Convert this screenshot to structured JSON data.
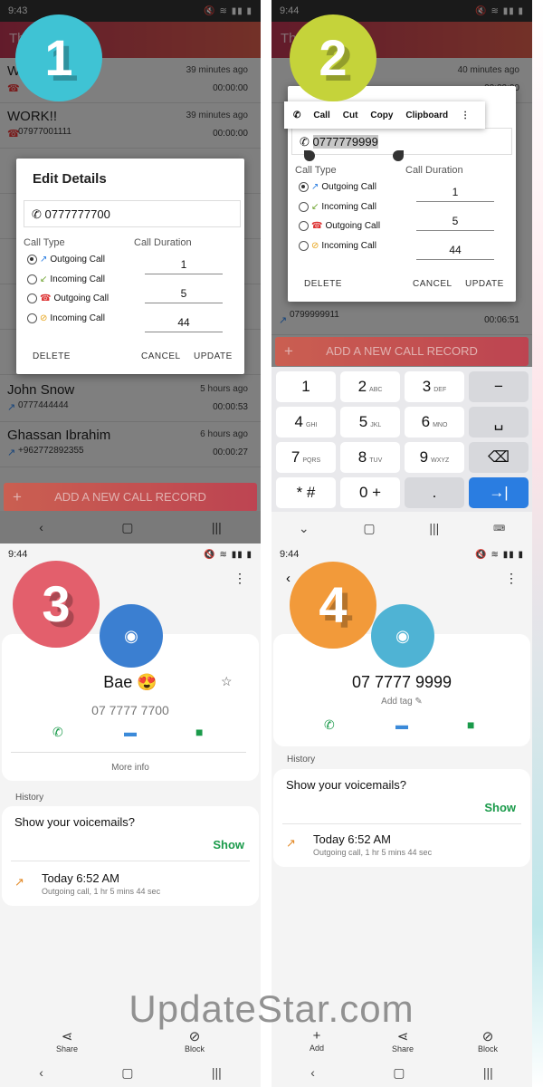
{
  "status": {
    "time1": "9:43",
    "time2": "9:44",
    "time3": "9:44",
    "time4": "9:44",
    "icons": "🔇 ≋ ▮▮ ▮"
  },
  "panel1": {
    "badge": "1",
    "appbar_title": "Th",
    "log": [
      {
        "name": "W",
        "time": "39 minutes ago",
        "number": "",
        "duration": "00:00:00"
      },
      {
        "name": "WORK!!",
        "time": "39 minutes ago",
        "number": "07977001111",
        "duration": "00:00:00"
      },
      {
        "name": "John Snow",
        "time": "5 hours ago",
        "number": "0777444444",
        "duration": "00:00:53"
      },
      {
        "name": "Ghassan Ibrahim",
        "time": "6 hours ago",
        "number": "+962772892355",
        "duration": "00:00:27"
      }
    ],
    "dialog": {
      "title": "Edit Details",
      "phone": "0777777700",
      "call_type_label": "Call Type",
      "call_duration_label": "Call Duration",
      "types": [
        "Outgoing Call",
        "Incoming Call",
        "Outgoing Call",
        "Incoming Call"
      ],
      "durations": [
        "1",
        "5",
        "44"
      ],
      "delete": "DELETE",
      "cancel": "CANCEL",
      "update": "UPDATE"
    },
    "add_button": "ADD A NEW CALL RECORD"
  },
  "panel2": {
    "badge": "2",
    "appbar_title": "Th",
    "log_top": {
      "time": "40 minutes ago",
      "duration": "00:00:00"
    },
    "log_bottom": {
      "number": "0799999911",
      "duration": "00:06:51"
    },
    "context_menu": [
      "Call",
      "Cut",
      "Copy",
      "Clipboard"
    ],
    "dialog": {
      "phone": "0777779999",
      "call_type_label": "Call Type",
      "call_duration_label": "Call Duration",
      "types": [
        "Outgoing Call",
        "Incoming Call",
        "Outgoing Call",
        "Incoming Call"
      ],
      "durations": [
        "1",
        "5",
        "44"
      ],
      "delete": "DELETE",
      "cancel": "CANCEL",
      "update": "UPDATE"
    },
    "add_button": "ADD A NEW CALL RECORD",
    "keys": [
      {
        "main": "1",
        "sub": ""
      },
      {
        "main": "2",
        "sub": "ABC"
      },
      {
        "main": "3",
        "sub": "DEF"
      },
      {
        "main": "−",
        "sub": ""
      },
      {
        "main": "4",
        "sub": "GHI"
      },
      {
        "main": "5",
        "sub": "JKL"
      },
      {
        "main": "6",
        "sub": "MNO"
      },
      {
        "main": "␣",
        "sub": ""
      },
      {
        "main": "7",
        "sub": "PQRS"
      },
      {
        "main": "8",
        "sub": "TUV"
      },
      {
        "main": "9",
        "sub": "WXYZ"
      },
      {
        "main": "⌫",
        "sub": ""
      },
      {
        "main": "* #",
        "sub": ""
      },
      {
        "main": "0 +",
        "sub": ""
      },
      {
        "main": ".",
        "sub": ""
      },
      {
        "main": "→|",
        "sub": ""
      }
    ]
  },
  "panel3": {
    "badge": "3",
    "name": "Bae 😍",
    "number": "07 7777 7700",
    "more_info": "More info",
    "history_label": "History",
    "voicemail_q": "Show your voicemails?",
    "show": "Show",
    "hist_time": "Today 6:52 AM",
    "hist_sub": "Outgoing call, 1 hr 5 mins 44 sec",
    "share": "Share",
    "block": "Block"
  },
  "panel4": {
    "badge": "4",
    "number": "07 7777 9999",
    "add_tag": "Add tag ✎",
    "history_label": "History",
    "voicemail_q": "Show your voicemails?",
    "show": "Show",
    "hist_time": "Today 6:52 AM",
    "hist_sub": "Outgoing call, 1 hr 5 mins 44 sec",
    "add": "Add",
    "share": "Share",
    "block": "Block"
  },
  "watermark": "UpdateStar.com",
  "colors": {
    "accent": "#c83a4a",
    "green": "#1a9a4a",
    "blue_avatar": "#3b7fd1",
    "teal_avatar": "#4fb3d4"
  }
}
